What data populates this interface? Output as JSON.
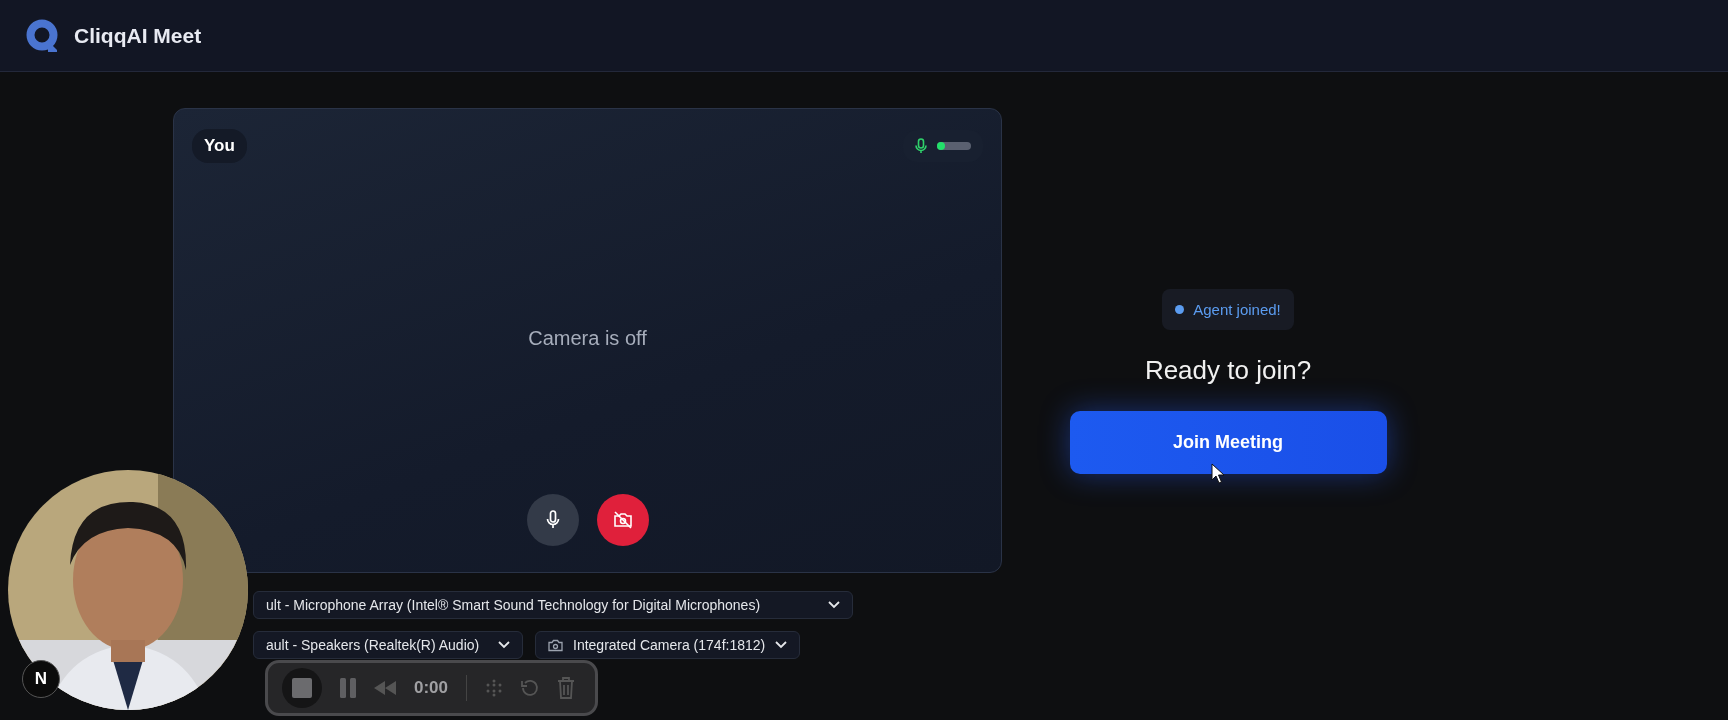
{
  "header": {
    "brand": "CliqqAI Meet"
  },
  "preview": {
    "name_badge": "You",
    "mic_meter": {
      "level": 0.12
    },
    "camera_status": "Camera is off",
    "controls": [
      {
        "kind": "mic",
        "on": true
      },
      {
        "kind": "camera",
        "on": false
      }
    ]
  },
  "devices": [
    {
      "kind": "microphone",
      "value": "ult - Microphone Array (Intel® Smart Sound Technology for Digital Microphones)"
    },
    {
      "kind": "speaker",
      "value": "ault - Speakers (Realtek(R) Audio)"
    },
    {
      "kind": "camera",
      "value": "Integrated Camera (174f:1812)"
    }
  ],
  "join_panel": {
    "status": {
      "text": "Agent joined!",
      "color": "#5b9cf0"
    },
    "title": "Ready to join?",
    "button": "Join Meeting"
  },
  "dev_badge": "N",
  "recorder": {
    "time": "0:00"
  }
}
